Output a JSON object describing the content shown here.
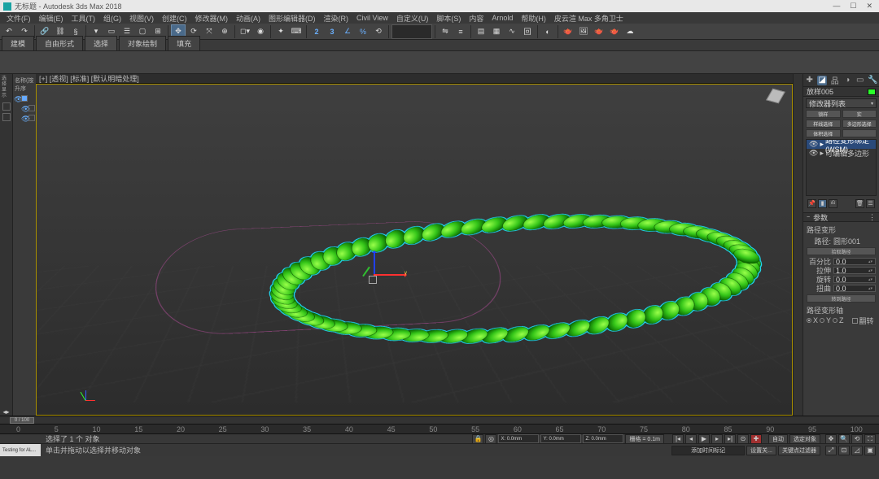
{
  "title": "无标题 - Autodesk 3ds Max 2018",
  "wincontrols": {
    "min": "—",
    "max": "☐",
    "close": "✕"
  },
  "menus": [
    "文件(F)",
    "编辑(E)",
    "工具(T)",
    "组(G)",
    "视图(V)",
    "创建(C)",
    "修改器(M)",
    "动画(A)",
    "图形编辑器(D)",
    "渲染(R)",
    "Civil View",
    "自定义(U)",
    "脚本(S)",
    "内容",
    "Arnold",
    "帮助(H)",
    "皮云渲 Max 多角卫士"
  ],
  "ribbon_tabs": [
    "建模",
    "自由形式",
    "选择",
    "对象绘制",
    "填充"
  ],
  "ribbon_active": 2,
  "left": {
    "col1": "选择  显示",
    "hdr": "名称(按升序"
  },
  "viewport": {
    "label": "[+] [透视] [标准] [默认明暗处理]"
  },
  "cmd": {
    "object_name": "放样005",
    "mod_dropdown": "修改器列表",
    "btns": {
      "a": "锁样",
      "b": "实",
      "c": "样线选择",
      "d": "多边形选择",
      "e": "体积选择"
    },
    "stack": [
      {
        "label": "路径变形绑定 (WSM)",
        "selected": true
      },
      {
        "label": "可编辑多边形",
        "selected": false
      }
    ],
    "rollout1": {
      "title": "参数",
      "path_label": "路径变形",
      "path_btn_lbl": "路径:",
      "path_val": "圆形001",
      "pick_btn": "拾取路径",
      "percent_lbl": "百分比",
      "percent_val": "0.0",
      "stretch_lbl": "拉伸",
      "stretch_val": "1.0",
      "rotate_lbl": "旋转",
      "rotate_val": "0.0",
      "twist_lbl": "扭曲",
      "twist_val": "0.0",
      "move_btn": "转到路径",
      "axis_title": "路径变形轴",
      "axes": [
        "X",
        "Y",
        "Z"
      ],
      "flip": "翻转"
    }
  },
  "timeline": {
    "scrub_label": "0 / 100",
    "ticks": [
      "0",
      "5",
      "10",
      "15",
      "20",
      "25",
      "30",
      "35",
      "40",
      "45",
      "50",
      "55",
      "60",
      "65",
      "70",
      "75",
      "80",
      "85",
      "90",
      "95",
      "100"
    ]
  },
  "status1": {
    "selection": "选择了 1 个 对象",
    "hint": "单击并拖动以选择并移动对象"
  },
  "status2": {
    "leftbox": "Testing for AL...",
    "coords_x": "X: 0.0mm",
    "coords_y": "Y: 0.0mm",
    "coords_z": "Z: 0.0mm",
    "grid": "栅格 = 0.1m",
    "autokey": "自动",
    "setkey": "设置关...",
    "addtime": "添加时间标记",
    "keyfilt": "选定对象",
    "keyfilt2": "关键点过滤器"
  },
  "icons": {
    "undo": "↶",
    "redo": "↷",
    "link": "🔗",
    "unlink": "⛓",
    "select": "▭",
    "move": "✥",
    "rotate": "⟳",
    "scale": "⤧",
    "mirror": "⇋",
    "align": "≡",
    "layer": "▤",
    "snap2": "2",
    "snap3": "3",
    "angle": "∠",
    "percent": "%",
    "render": "🫖",
    "lock": "🔒",
    "key": "🗝",
    "play_first": "|◂",
    "play_prev": "◂",
    "play": "▶",
    "play_next": "▸",
    "play_last": "▸|",
    "keybtn": "🔑"
  }
}
